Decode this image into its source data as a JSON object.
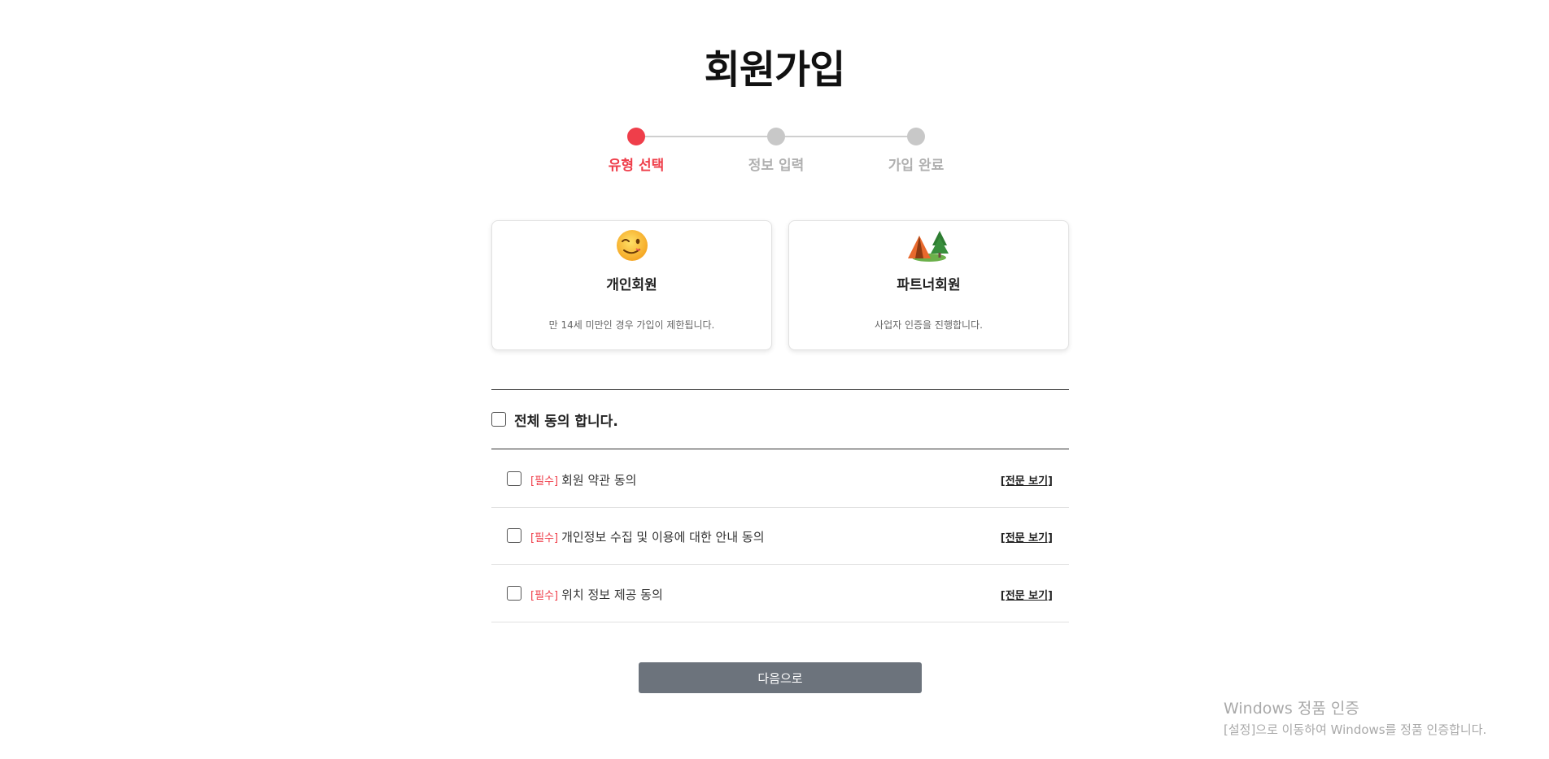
{
  "page": {
    "title": "회원가입"
  },
  "stepper": {
    "steps": [
      {
        "label": "유형 선택",
        "active": true
      },
      {
        "label": "정보 입력",
        "active": false
      },
      {
        "label": "가입 완료",
        "active": false
      }
    ],
    "active_color": "#ef3e4a",
    "inactive_color": "#c8c8c8"
  },
  "member_types": [
    {
      "icon": "winking-face-icon",
      "title": "개인회원",
      "desc": "만 14세 미만인 경우 가입이 제한됩니다."
    },
    {
      "icon": "tent-camping-icon",
      "title": "파트너회원",
      "desc": "사업자 인증을 진행합니다."
    }
  ],
  "agreement": {
    "all_label": "전체 동의 합니다.",
    "terms": [
      {
        "required_tag": "[필수]",
        "label": "회원 약관 동의",
        "view_label": "[전문 보기]"
      },
      {
        "required_tag": "[필수]",
        "label": "개인정보 수집 및 이용에 대한 안내 동의",
        "view_label": "[전문 보기]"
      },
      {
        "required_tag": "[필수]",
        "label": "위치 정보 제공 동의",
        "view_label": "[전문 보기]"
      }
    ]
  },
  "next_button": {
    "label": "다음으로",
    "color": "#6c737c"
  },
  "os_watermark": {
    "line1": "Windows 정품 인증",
    "line2": "[설정]으로 이동하여 Windows를 정품 인증합니다."
  }
}
